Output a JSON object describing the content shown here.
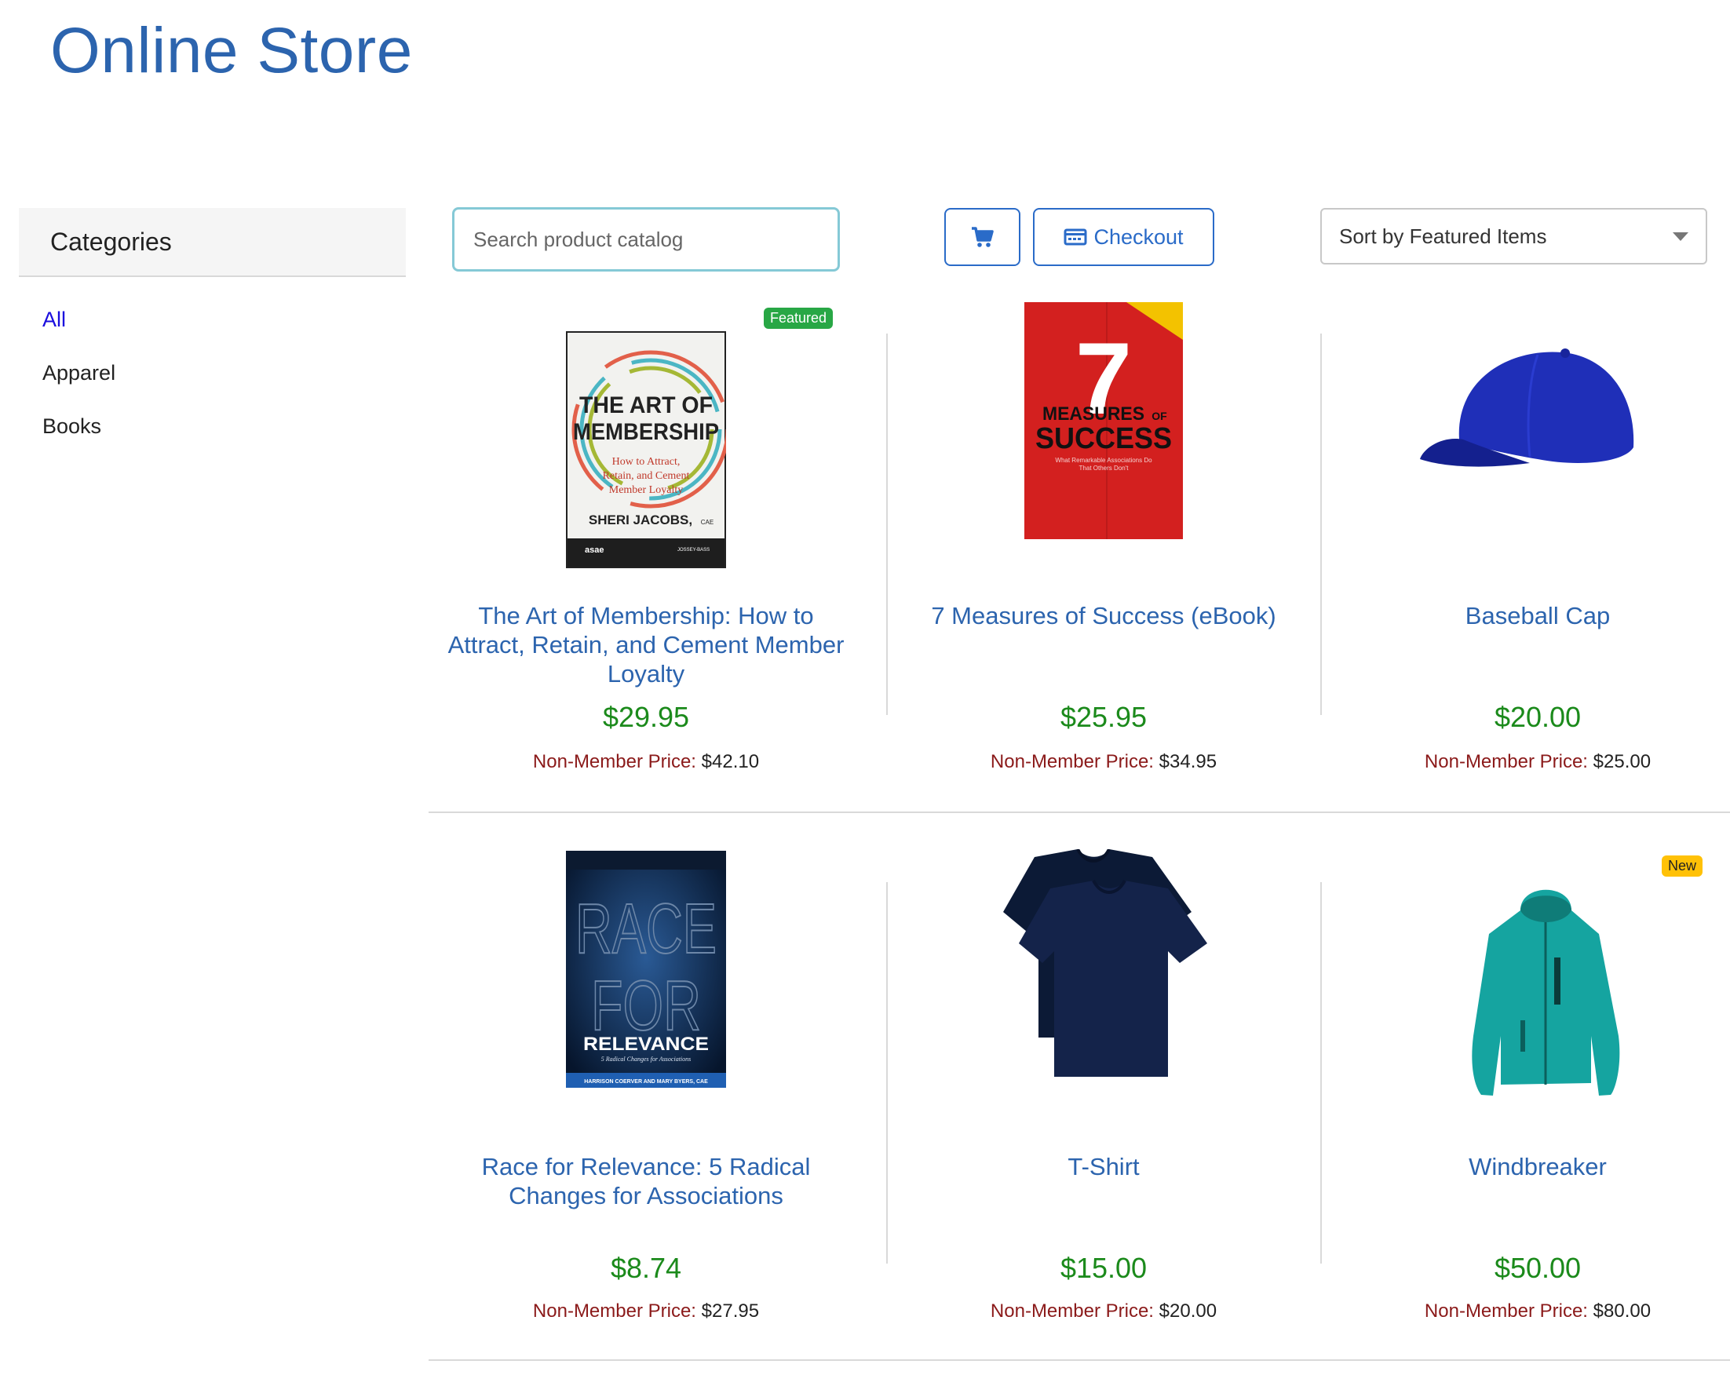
{
  "page": {
    "title": "Online Store"
  },
  "sidebar": {
    "header": "Categories",
    "items": [
      {
        "label": "All",
        "active": true
      },
      {
        "label": "Apparel",
        "active": false
      },
      {
        "label": "Books",
        "active": false
      }
    ]
  },
  "toolbar": {
    "search_placeholder": "Search product catalog",
    "cart_icon": "cart-icon",
    "checkout_label": "Checkout",
    "checkout_icon": "credit-card-icon",
    "sort_label": "Sort by Featured Items"
  },
  "colors": {
    "brand_blue": "#2c64ae",
    "price_green": "#1b8a1b",
    "nonmember_red": "#8b1a1a",
    "featured_badge": "#28a745",
    "new_badge": "#ffc107"
  },
  "nonmember_label": "Non-Member Price:",
  "products": [
    {
      "name": "The Art of Membership: How to Attract, Retain, and Cement Member Loyalty",
      "price": "$29.95",
      "nonmember_price": "$42.10",
      "badge": "Featured",
      "image": {
        "title_line1": "THE ART OF",
        "title_line2": "MEMBERSHIP",
        "subtitle_line1": "How to Attract,",
        "subtitle_line2": "Retain, and Cement",
        "subtitle_line3": "Member Loyalty",
        "author": "SHERI JACOBS,",
        "author_suffix": "CAE",
        "publisher_left": "asae",
        "publisher_right": "JOSSEY-BASS"
      }
    },
    {
      "name": "7 Measures of Success (eBook)",
      "price": "$25.95",
      "nonmember_price": "$34.95",
      "badge": "",
      "image": {
        "number": "7",
        "title_line1": "MEASURES",
        "title_of": "OF",
        "title_line2": "SUCCESS",
        "tagline_line1": "What Remarkable Associations Do",
        "tagline_line2": "That Others Don't"
      }
    },
    {
      "name": "Baseball Cap",
      "price": "$20.00",
      "nonmember_price": "$25.00",
      "badge": "",
      "image": {
        "icon": "baseball-cap"
      }
    },
    {
      "name": "Race for Relevance: 5 Radical Changes for Associations",
      "price": "$8.74",
      "nonmember_price": "$27.95",
      "badge": "",
      "image": {
        "title_line1": "RACE",
        "title_line2": "FOR",
        "title_line3": "RELEVANCE",
        "subtitle": "5 Radical Changes for Associations",
        "authors": "HARRISON COERVER AND MARY BYERS, CAE"
      }
    },
    {
      "name": "T-Shirt",
      "price": "$15.00",
      "nonmember_price": "$20.00",
      "badge": "",
      "image": {
        "icon": "t-shirt"
      }
    },
    {
      "name": "Windbreaker",
      "price": "$50.00",
      "nonmember_price": "$80.00",
      "badge": "New",
      "image": {
        "icon": "jacket"
      }
    }
  ]
}
